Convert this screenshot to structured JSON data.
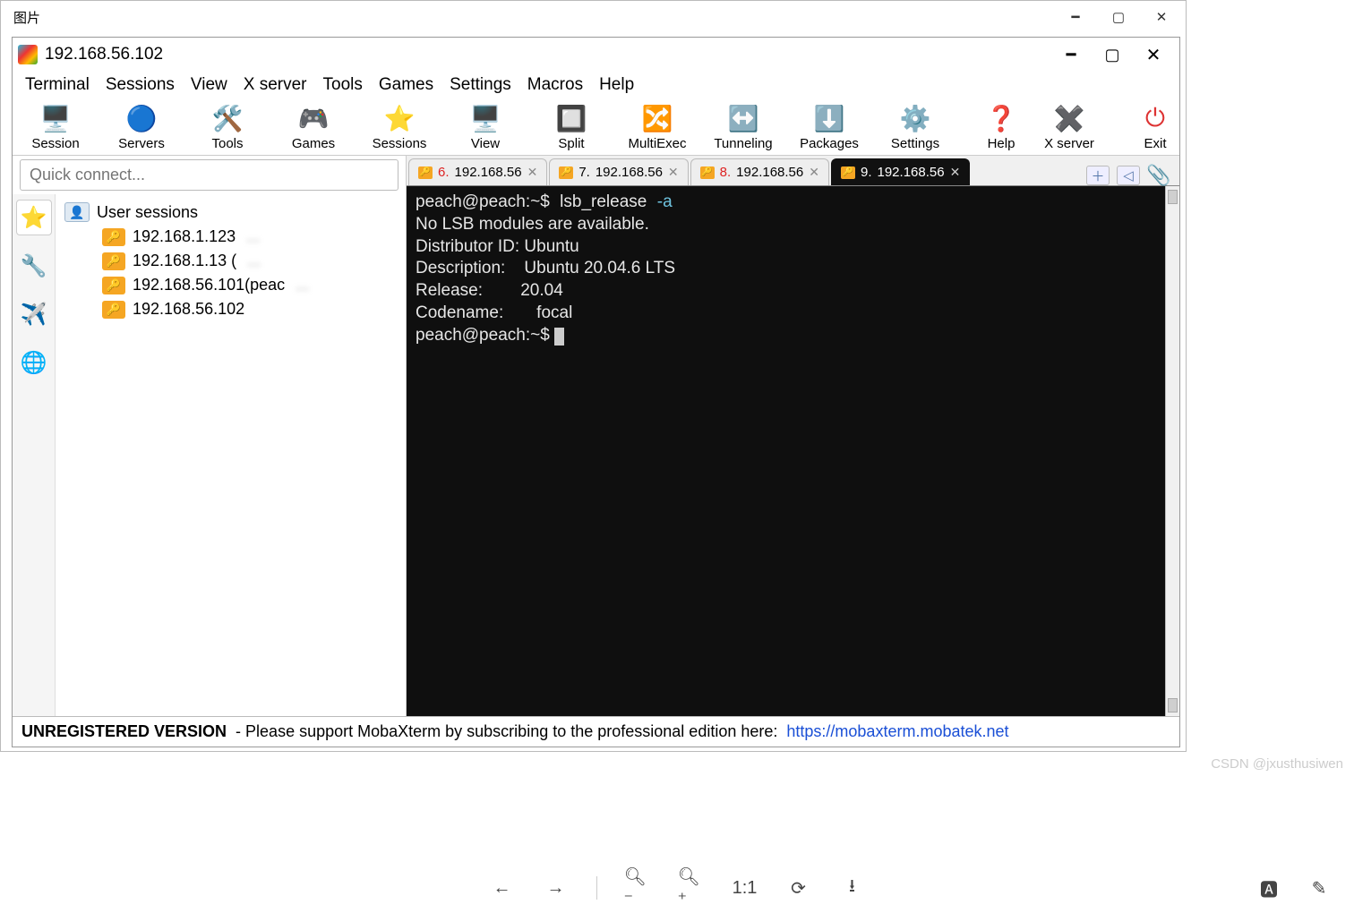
{
  "viewer": {
    "title": "图片"
  },
  "app": {
    "title": "192.168.56.102"
  },
  "menubar": [
    "Terminal",
    "Sessions",
    "View",
    "X server",
    "Tools",
    "Games",
    "Settings",
    "Macros",
    "Help"
  ],
  "toolbar": {
    "left": [
      {
        "label": "Session",
        "icon": "🖥️"
      },
      {
        "label": "Servers",
        "icon": "🔵"
      },
      {
        "label": "Tools",
        "icon": "🛠️"
      },
      {
        "label": "Games",
        "icon": "🎮"
      },
      {
        "label": "Sessions",
        "icon": "⭐"
      },
      {
        "label": "View",
        "icon": "🖥️"
      },
      {
        "label": "Split",
        "icon": "🔲"
      },
      {
        "label": "MultiExec",
        "icon": "🔀"
      },
      {
        "label": "Tunneling",
        "icon": "↔️"
      },
      {
        "label": "Packages",
        "icon": "⬇️"
      },
      {
        "label": "Settings",
        "icon": "⚙️"
      },
      {
        "label": "Help",
        "icon": "❓"
      }
    ],
    "right": [
      {
        "label": "X server",
        "icon": "✖️"
      },
      {
        "label": "Exit",
        "icon": "⏻"
      }
    ]
  },
  "quick_connect_placeholder": "Quick connect...",
  "sidebar_tabs": [
    {
      "icon": "⭐",
      "active": true
    },
    {
      "icon": "🔧",
      "active": false
    },
    {
      "icon": "✈️",
      "active": false
    },
    {
      "icon": "🌐",
      "active": false
    }
  ],
  "tree": {
    "root": "User sessions",
    "items": [
      {
        "label": "192.168.1.123",
        "blur": "..."
      },
      {
        "label": "192.168.1.13 (",
        "blur": "..."
      },
      {
        "label": "192.168.56.101(peac",
        "blur": "..."
      },
      {
        "label": "192.168.56.102",
        "blur": ""
      }
    ]
  },
  "tabs": [
    {
      "num": "6.",
      "label": "192.168.56",
      "active": false,
      "red": true
    },
    {
      "num": "7.",
      "label": "192.168.56",
      "active": false,
      "red": false
    },
    {
      "num": "8.",
      "label": "192.168.56",
      "active": false,
      "red": true
    },
    {
      "num": "9.",
      "label": "192.168.56",
      "active": true,
      "red": false
    }
  ],
  "terminal": {
    "prompt": "peach@peach:~$",
    "command": "lsb_release",
    "flag": "-a",
    "lines": [
      "No LSB modules are available.",
      "Distributor ID: Ubuntu",
      "Description:    Ubuntu 20.04.6 LTS",
      "Release:        20.04",
      "Codename:       focal"
    ],
    "prompt2": "peach@peach:~$ "
  },
  "status": {
    "bold": "UNREGISTERED VERSION",
    "text": "  -  Please support MobaXterm by subscribing to the professional edition here:  ",
    "link": "https://mobaxterm.mobatek.net"
  },
  "watermark": "CSDN @jxusthusiwen"
}
